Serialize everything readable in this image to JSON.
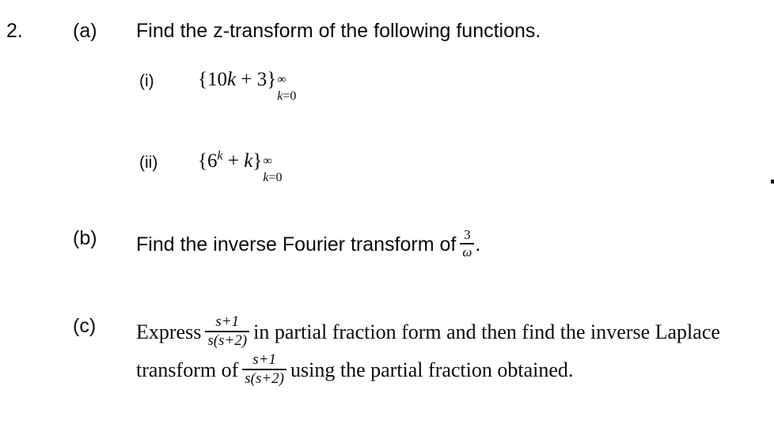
{
  "document": {
    "question_number": "2.",
    "parts": [
      {
        "label": "(a)",
        "text": "Find the z-transform of the following functions.",
        "subparts": [
          {
            "label": "(i)",
            "expression": {
              "open_brace": "{",
              "body_prefix": "10",
              "body_var": "k",
              "plus": " + ",
              "body_const": "3",
              "close_brace": "}",
              "upper_limit": "∞",
              "lower_limit_var": "k",
              "lower_limit_value": "=0"
            }
          },
          {
            "label": "(ii)",
            "expression": {
              "open_brace": "{",
              "base": "6",
              "exponent": "k",
              "plus": " + ",
              "term": "k",
              "close_brace": "}",
              "upper_limit": "∞",
              "lower_limit_var": "k",
              "lower_limit_value": "=0"
            }
          }
        ]
      },
      {
        "label": "(b)",
        "text_before": "Find the inverse Fourier transform of",
        "fraction": {
          "numerator": "3",
          "denominator": "ω"
        },
        "text_after": "."
      },
      {
        "label": "(c)",
        "line1": {
          "text_before": "Express",
          "fraction": {
            "numerator": "s+1",
            "denominator": "s(s+2)"
          },
          "text_after": "in partial fraction form and then find the inverse Laplace"
        },
        "line2": {
          "text_before": "transform of",
          "fraction": {
            "numerator": "s+1",
            "denominator": "s(s+2)"
          },
          "text_after": "using the partial fraction obtained."
        }
      }
    ]
  },
  "colors": {
    "ink": "#0a0a10",
    "page": "#ffffff"
  }
}
